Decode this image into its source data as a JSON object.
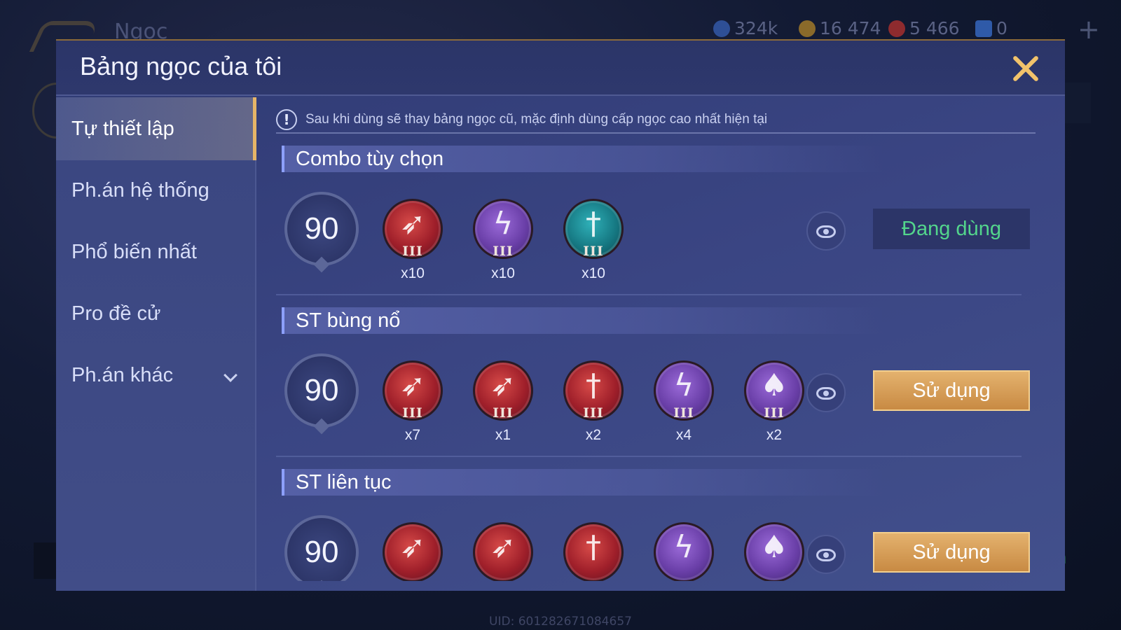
{
  "background": {
    "title": "Ngọc",
    "resources": [
      {
        "icon": "blue-gem-icon",
        "value": "324k",
        "color": "#3a63b8"
      },
      {
        "icon": "gold-coin-icon",
        "value": "16 474",
        "color": "#b88a2c"
      },
      {
        "icon": "red-voucher-icon",
        "value": "5 466",
        "color": "#b8373a"
      },
      {
        "icon": "blue-card-icon",
        "value": "0",
        "color": "#3d6fd0"
      }
    ],
    "uid": "UID: 601282671084657",
    "right_text": "ía"
  },
  "dialog": {
    "title": "Bảng ngọc của tôi",
    "notice": "Sau khi dùng sẽ thay bảng ngọc cũ, mặc định dùng cấp ngọc cao nhất hiện tại",
    "notice_icon": "!"
  },
  "sidebar": {
    "items": [
      {
        "label": "Tự thiết lập",
        "active": true
      },
      {
        "label": "Ph.án hệ thống",
        "active": false
      },
      {
        "label": "Phổ biến nhất",
        "active": false
      },
      {
        "label": "Pro đề cử",
        "active": false
      },
      {
        "label": "Ph.án khác",
        "active": false,
        "dropdown": true
      }
    ]
  },
  "presets": [
    {
      "title": "Combo tùy chọn",
      "level": "90",
      "gems": [
        {
          "color": "red",
          "icon": "blade-icon",
          "tier": "III",
          "count": "x10"
        },
        {
          "color": "purple",
          "icon": "lightning-icon",
          "tier": "III",
          "count": "x10"
        },
        {
          "color": "teal",
          "icon": "sword-icon",
          "tier": "III",
          "count": "x10"
        }
      ],
      "action": "Đang dùng",
      "action_state": "in-use"
    },
    {
      "title": "ST bùng nổ",
      "level": "90",
      "gems": [
        {
          "color": "red",
          "icon": "blade-icon",
          "tier": "III",
          "count": "x7"
        },
        {
          "color": "red",
          "icon": "blade-icon",
          "tier": "III",
          "count": "x1"
        },
        {
          "color": "red",
          "icon": "sword-icon",
          "tier": "III",
          "count": "x2"
        },
        {
          "color": "purple",
          "icon": "lightning-icon",
          "tier": "III",
          "count": "x4"
        },
        {
          "color": "purple",
          "icon": "flame-icon",
          "tier": "III",
          "count": "x2"
        }
      ],
      "action": "Sử dụng",
      "action_state": "available"
    },
    {
      "title": "ST liên tục",
      "level": "90",
      "gems": [
        {
          "color": "red",
          "icon": "blade-icon"
        },
        {
          "color": "red",
          "icon": "blade-icon"
        },
        {
          "color": "red",
          "icon": "sword-icon"
        },
        {
          "color": "purple",
          "icon": "lightning-icon"
        },
        {
          "color": "purple",
          "icon": "flame-icon"
        }
      ],
      "action": "Sử dụng",
      "action_state": "available"
    }
  ]
}
